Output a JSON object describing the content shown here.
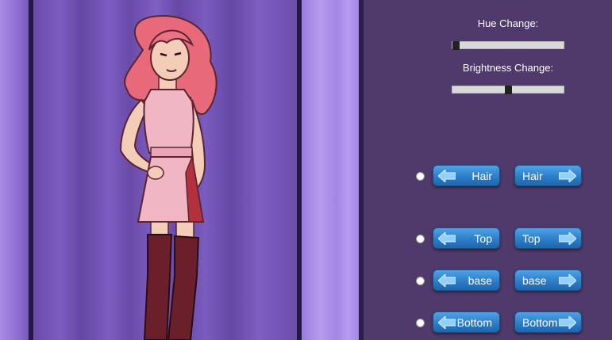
{
  "sliders": {
    "hue": {
      "label": "Hue Change:",
      "value": 0.0
    },
    "brightness": {
      "label": "Brightness Change:",
      "value": 0.5
    }
  },
  "rows": [
    {
      "part": "hair",
      "prev_label": "Hair",
      "next_label": "Hair"
    },
    {
      "part": "top",
      "prev_label": "Top",
      "next_label": "Top"
    },
    {
      "part": "base",
      "prev_label": "base",
      "next_label": "base"
    },
    {
      "part": "bottom",
      "prev_label": "Bottom",
      "next_label": "Bottom"
    }
  ],
  "icons": {
    "prev": "arrow-left-icon",
    "next": "arrow-right-icon"
  },
  "colors": {
    "panel": "#4f3a6b",
    "curtain": "#7a59b8",
    "button": "#2d7dc8",
    "hair": "#e86a7a",
    "dress": "#f0b6c4",
    "boots": "#6b1f2b"
  }
}
